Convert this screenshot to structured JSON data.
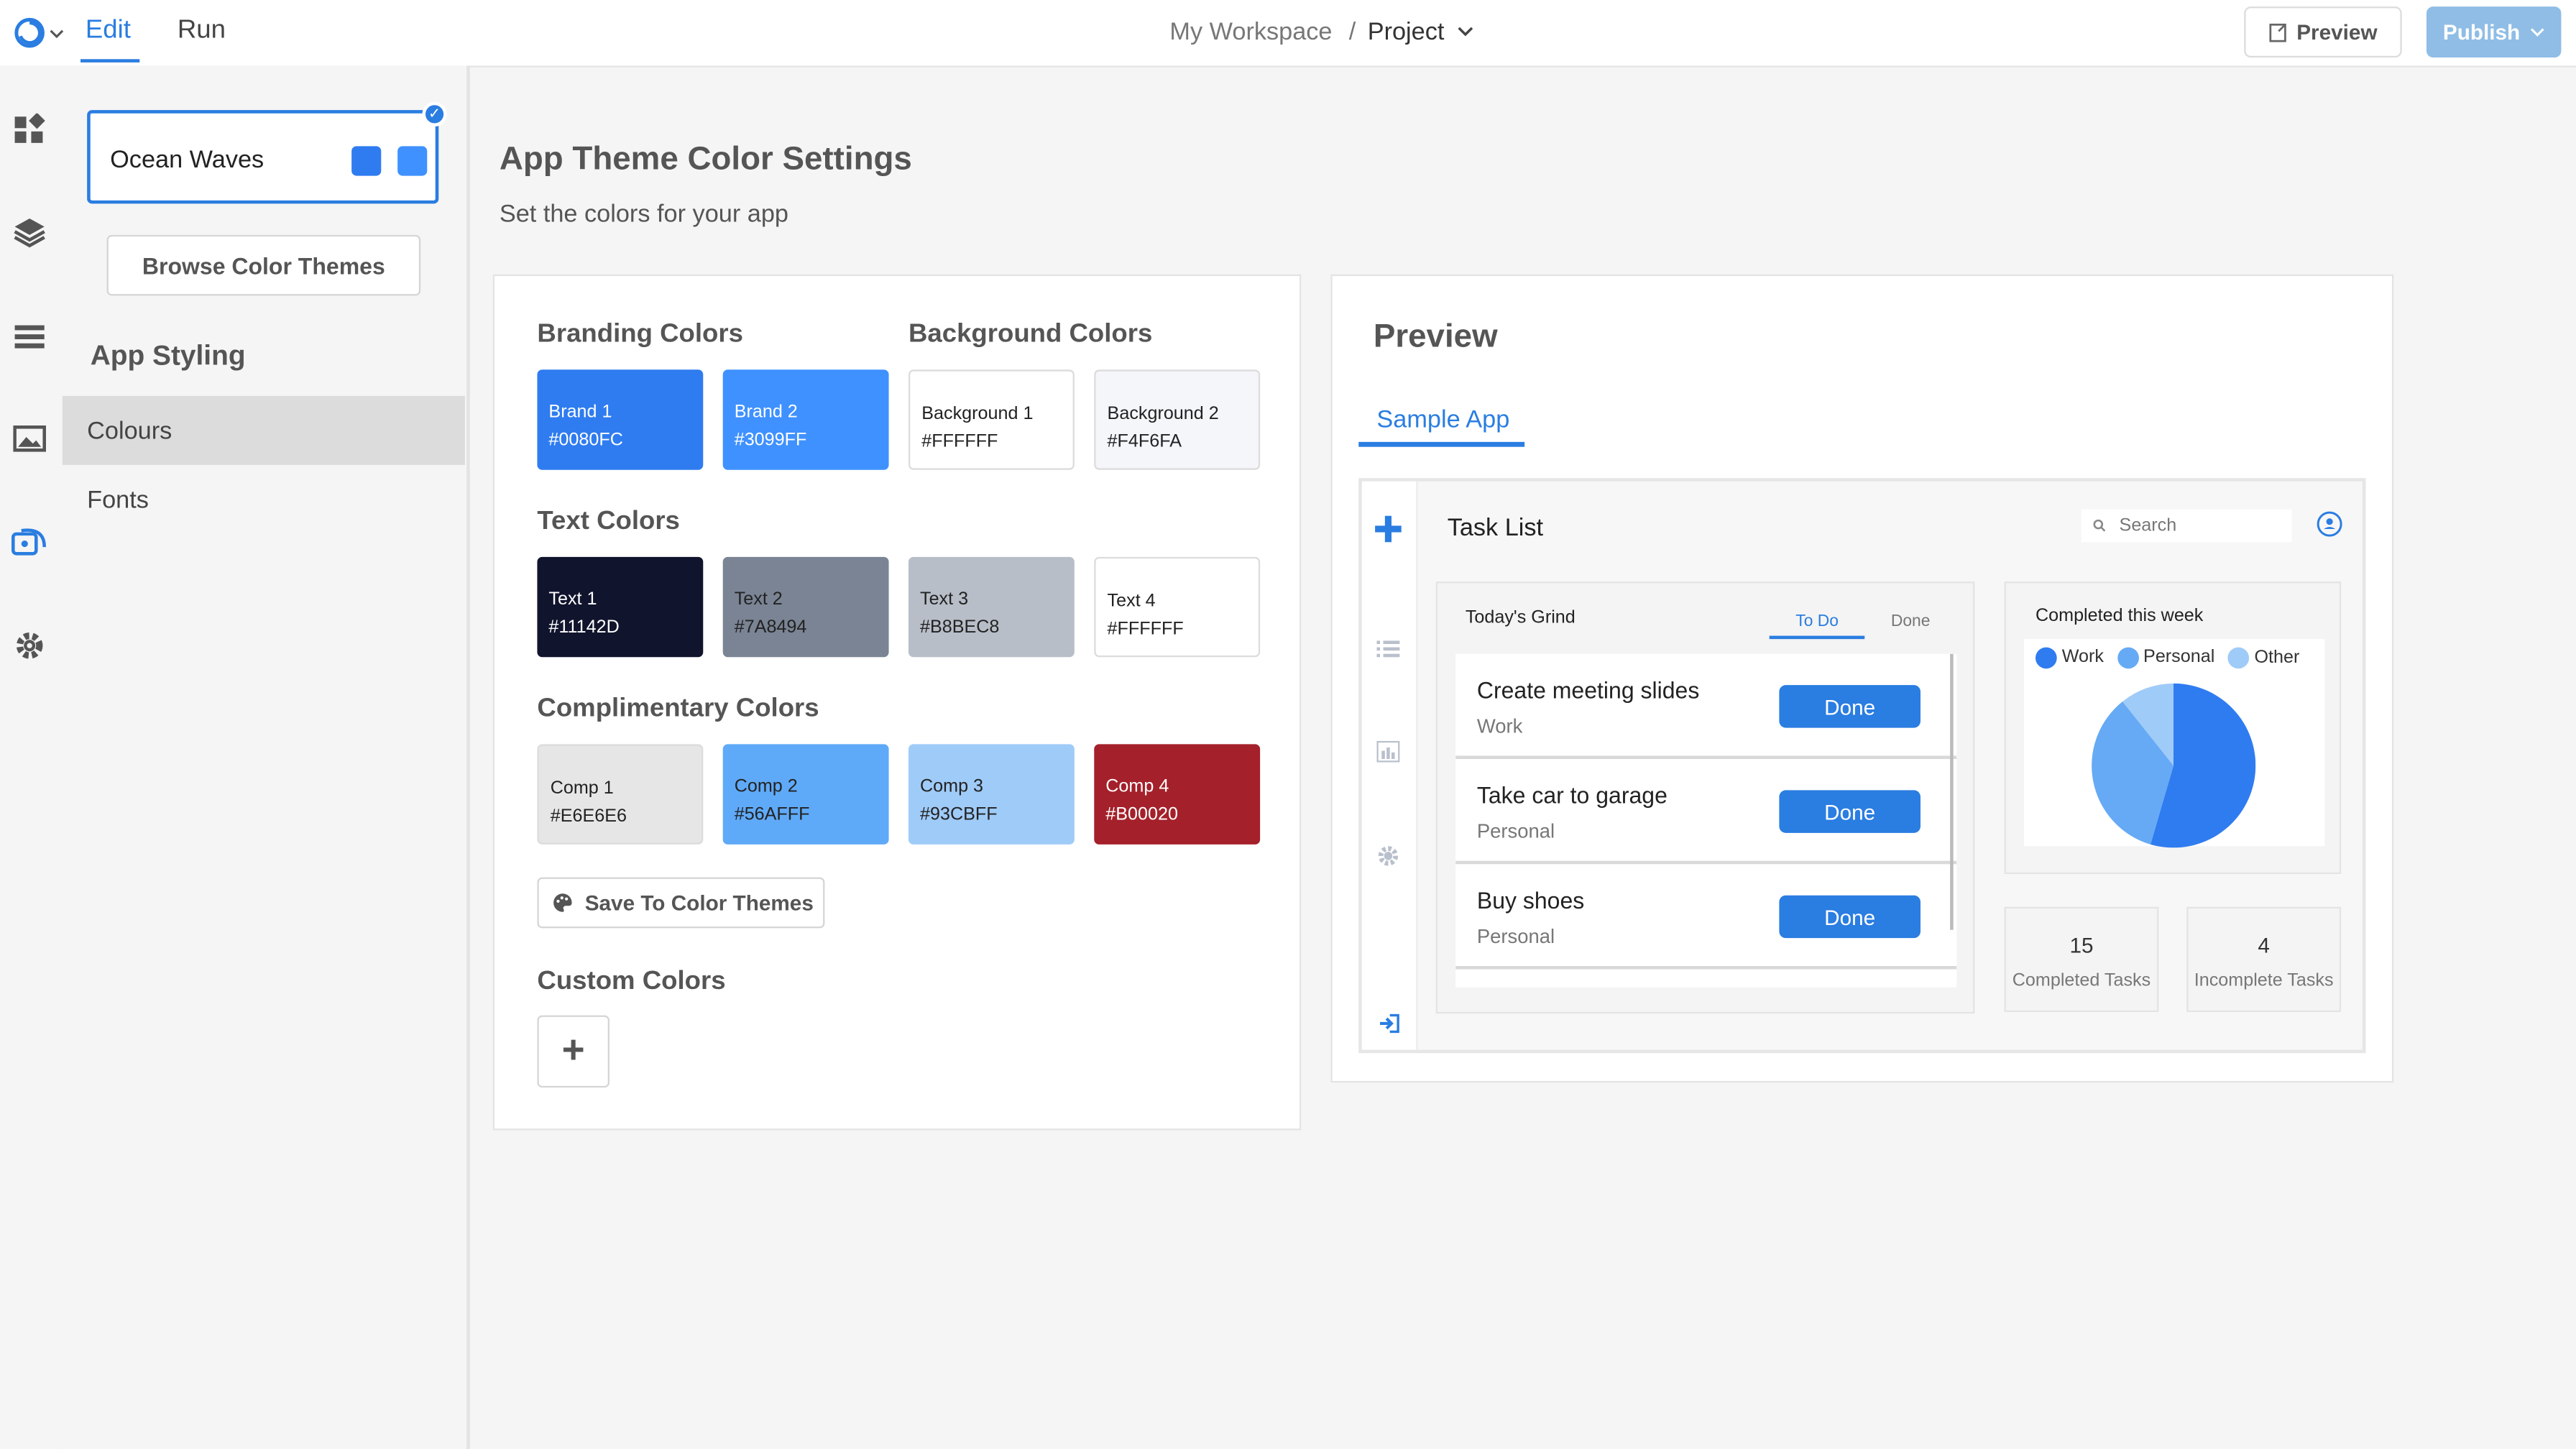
{
  "topbar": {
    "edit_tab": "Edit",
    "run_tab": "Run",
    "workspace": "My Workspace",
    "separator": "/",
    "project": "Project",
    "preview_button": "Preview",
    "publish_button": "Publish"
  },
  "rail": {
    "icons": [
      "components-icon",
      "layers-icon",
      "data-icon",
      "media-icon",
      "theme-icon",
      "settings-icon"
    ]
  },
  "sidepanel": {
    "theme_card": {
      "name": "Ocean Waves",
      "swatch_colors": [
        "#2f7cf0",
        "#3f91ff"
      ]
    },
    "browse_button": "Browse Color Themes",
    "heading": "App Styling",
    "items": [
      {
        "label": "Colours",
        "active": true
      },
      {
        "label": "Fonts",
        "active": false
      }
    ]
  },
  "main": {
    "title": "App Theme Color Settings",
    "subtitle": "Set the colors for your app",
    "branding_title": "Branding Colors",
    "background_title": "Background Colors",
    "text_title": "Text Colors",
    "comp_title": "Complimentary Colors",
    "custom_title": "Custom Colors",
    "save_button": "Save To Color Themes",
    "add_custom": "+",
    "branding": [
      {
        "name": "Brand 1",
        "hex": "#0080FC"
      },
      {
        "name": "Brand 2",
        "hex": "#3099FF"
      }
    ],
    "backgrounds": [
      {
        "name": "Background 1",
        "hex": "#FFFFFF"
      },
      {
        "name": "Background 2",
        "hex": "#F4F6FA"
      }
    ],
    "texts": [
      {
        "name": "Text 1",
        "hex": "#11142D"
      },
      {
        "name": "Text 2",
        "hex": "#7A8494"
      },
      {
        "name": "Text 3",
        "hex": "#B8BEC8"
      },
      {
        "name": "Text 4",
        "hex": "#FFFFFF"
      }
    ],
    "comps": [
      {
        "name": "Comp 1",
        "hex": "#E6E6E6"
      },
      {
        "name": "Comp 2",
        "hex": "#56AFFF"
      },
      {
        "name": "Comp 3",
        "hex": "#93CBFF"
      },
      {
        "name": "Comp 4",
        "hex": "#B00020"
      }
    ]
  },
  "preview": {
    "title": "Preview",
    "tab": "Sample App",
    "app": {
      "title": "Task List",
      "search_placeholder": "Search",
      "todo": {
        "heading": "Today's Grind",
        "tab_todo": "To Do",
        "tab_done": "Done",
        "tasks": [
          {
            "name": "Create meeting slides",
            "category": "Work",
            "button": "Done"
          },
          {
            "name": "Take car to garage",
            "category": "Personal",
            "button": "Done"
          },
          {
            "name": "Buy shoes",
            "category": "Personal",
            "button": "Done"
          }
        ]
      },
      "pie": {
        "heading": "Completed this week",
        "legend": [
          {
            "label": "Work",
            "color": "#2f7cf0"
          },
          {
            "label": "Personal",
            "color": "#66aaf5"
          },
          {
            "label": "Other",
            "color": "#9fcbf8"
          }
        ]
      },
      "stats": [
        {
          "value": "15",
          "label": "Completed Tasks"
        },
        {
          "value": "4",
          "label": "Incomplete Tasks"
        }
      ]
    }
  }
}
